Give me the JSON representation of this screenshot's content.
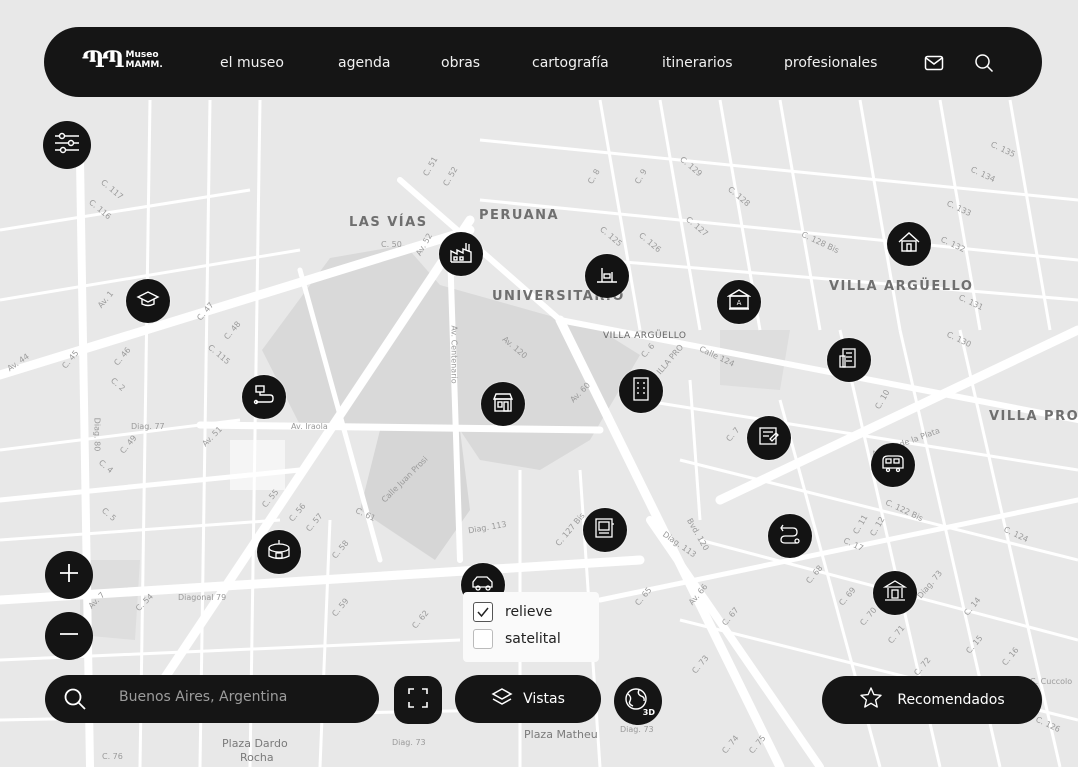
{
  "header": {
    "logo_mark": "ՊՊ",
    "logo_line1": "Museo",
    "logo_line2": "MAMM.",
    "nav": [
      "el museo",
      "agenda",
      "obras",
      "cartografía",
      "itinerarios",
      "profesionales"
    ]
  },
  "map": {
    "neighborhoods": [
      "LAS VÍAS",
      "PERUANA",
      "UNIVERSITARIO",
      "VILLA ARGÜELLO",
      "VILLA PROG"
    ],
    "small_area": "VILLA ARGÜELLO",
    "places": [
      "Plaza Dardo",
      "Rocha",
      "Plaza Matheu"
    ],
    "streets": [
      "C. 50",
      "C. 51",
      "C. 52",
      "Av. 52",
      "C. 47",
      "C. 48",
      "C. 45",
      "C. 46",
      "C. 49",
      "Av. 44",
      "Av. 1",
      "C. 116",
      "C. 117",
      "C. 115",
      "C. 2",
      "C. 4",
      "C. 5",
      "Diag. 80",
      "Diag. 77",
      "Av. 51",
      "Av. Iraola",
      "Av. Centenario",
      "Av. 120",
      "Av. 60",
      "C. 125",
      "C. 126",
      "C. 127",
      "C. 128",
      "C. 129",
      "C. 6",
      "C. 7",
      "C. 8",
      "C. 9",
      "C. 10",
      "C. 11",
      "C. 12",
      "C. 128 Bis",
      "C. 132",
      "C. 133",
      "C. 134",
      "C. 135",
      "C. 130",
      "C. 131",
      "Calle 124",
      "Av. Río de la Plata",
      "Diag. 113",
      "C. 55",
      "C. 56",
      "C. 57",
      "C. 58",
      "C. 59",
      "Diagonal 79",
      "C. 54",
      "Av. 7",
      "Bvd. 120",
      "Diag. 113",
      "Av. 66",
      "C. 65",
      "C. 67",
      "C. 68",
      "C. 69",
      "C. 70",
      "C. 71",
      "C. 72",
      "C. 73",
      "C. 74",
      "C. 75",
      "C. 76",
      "Diag. 73",
      "Diag. 73",
      "Diag. 73",
      "C. 14",
      "C. 15",
      "C. 16",
      "C. 17",
      "C. 122 Bis",
      "C. 124",
      "C. 126",
      "C. 127 Bis",
      "C. 62",
      "C. 61",
      "Calle Juan Prosi",
      "C. Cuccolo",
      "ILLA PRO",
      "C. 123"
    ]
  },
  "layers": {
    "relief_label": "relieve",
    "relief_checked": true,
    "satellite_label": "satelital",
    "satellite_checked": false
  },
  "search": {
    "placeholder": "Buenos Aires, Argentina"
  },
  "views_label": "Vistas",
  "label_3d": "3D",
  "recommended_label": "Recomendados",
  "colors": {
    "bar": "#151515",
    "map_bg": "#e6e6e6",
    "road": "#ffffff",
    "block": "#d6d6d6"
  },
  "markers": [
    "factory-icon",
    "building-sign-icon",
    "museum-icon",
    "house-icon",
    "graduation-cap-icon",
    "route-icon",
    "shop-icon",
    "office-building-icon",
    "blueprint-icon",
    "apartment-icon",
    "tram-icon",
    "stadium-icon",
    "stage-icon",
    "map-pin-route-icon",
    "landmark-icon",
    "vehicle-icon"
  ]
}
